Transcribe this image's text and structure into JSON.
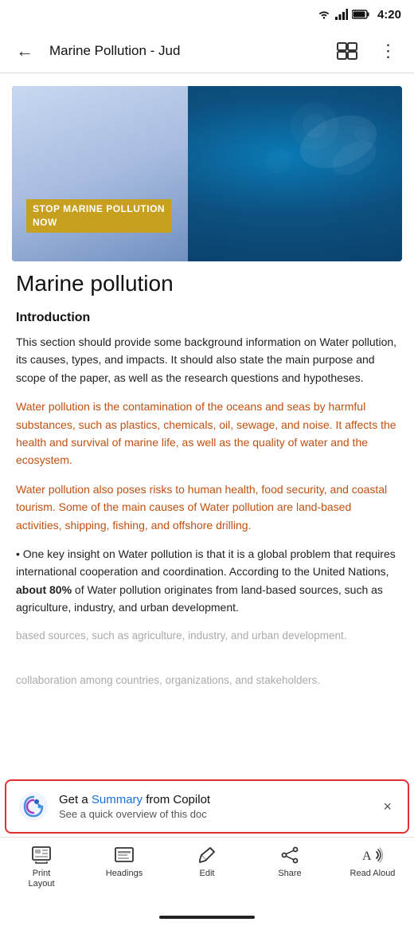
{
  "statusBar": {
    "time": "4:20"
  },
  "topNav": {
    "backLabel": "←",
    "title": "Marine Pollution - Jud",
    "layoutIconLabel": "⧉",
    "moreIconLabel": "⋮"
  },
  "hero": {
    "overlayLine1": "STOP MARINE POLLUTION",
    "overlayLine2": "NOW"
  },
  "document": {
    "mainTitle": "Marine pollution",
    "sections": [
      {
        "heading": "Introduction",
        "paragraphs": [
          {
            "text": "This section should provide some background information on Water pollution, its causes, types, and impacts. It should also state the main purpose and scope of the paper, as well as the research questions and hypotheses.",
            "style": "normal"
          },
          {
            "text": "Water pollution is the contamination of the oceans and seas by harmful substances, such as plastics, chemicals, oil, sewage, and noise. It affects the health and survival of marine life, as well as the quality of water and the ecosystem.",
            "style": "orange"
          },
          {
            "text": "Water pollution also poses risks to human health, food security, and coastal tourism. Some of the main causes of Water pollution are land-based activities, shipping, fishing, and offshore drilling.",
            "style": "orange"
          },
          {
            "text": "• One key insight on Water pollution is that it is a global problem that requires international cooperation and coordination. According to the United Nations, bold:about 80% of Water pollution originates from land-based sources, such as agriculture, industry, and urban development.",
            "style": "normal"
          },
          {
            "text": "collaboration among countries, organizations, and stakeholders.",
            "style": "faded"
          }
        ]
      }
    ]
  },
  "copilotBanner": {
    "line1Prefix": "Get a ",
    "line1Link": "Summary",
    "line1Suffix": " from Copilot",
    "line2": "See a quick overview of this doc",
    "closeLabel": "×"
  },
  "bottomNav": {
    "items": [
      {
        "id": "print-layout",
        "icon": "print-layout-icon",
        "label": "Print\nLayout"
      },
      {
        "id": "headings",
        "icon": "headings-icon",
        "label": "Headings"
      },
      {
        "id": "edit",
        "icon": "edit-icon",
        "label": "Edit"
      },
      {
        "id": "share",
        "icon": "share-icon",
        "label": "Share"
      },
      {
        "id": "read-aloud",
        "icon": "read-aloud-icon",
        "label": "Read Aloud"
      }
    ]
  }
}
